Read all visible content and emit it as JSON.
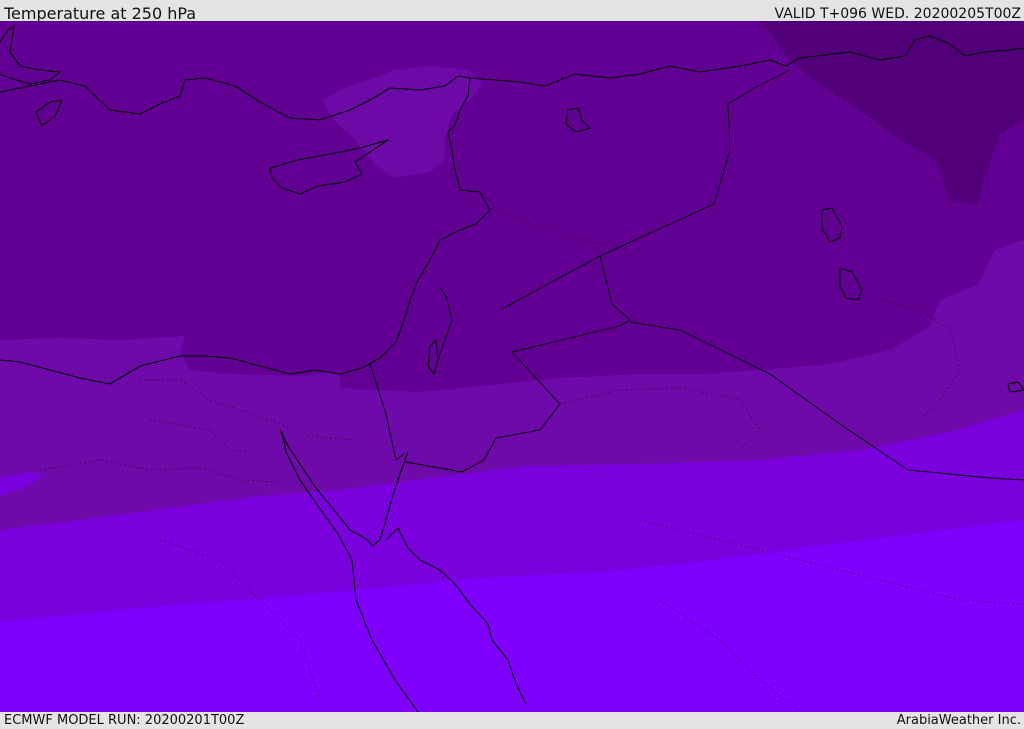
{
  "header": {
    "title": "Temperature at 250 hPa",
    "valid": "VALID T+096 WED. 20200205T00Z"
  },
  "footer": {
    "model_run": "ECMWF MODEL RUN: 20200201T00Z",
    "brand": "ArabiaWeather Inc."
  },
  "map": {
    "variable": "temperature",
    "level": "250 hPa",
    "region": "Eastern Mediterranean / Middle East",
    "palette": {
      "darkest": "#520079",
      "dark": "#620093",
      "mid_dark": "#6f0aaa",
      "mid": "#7a00de",
      "bright": "#8000ff",
      "coastline": "#000000"
    }
  }
}
